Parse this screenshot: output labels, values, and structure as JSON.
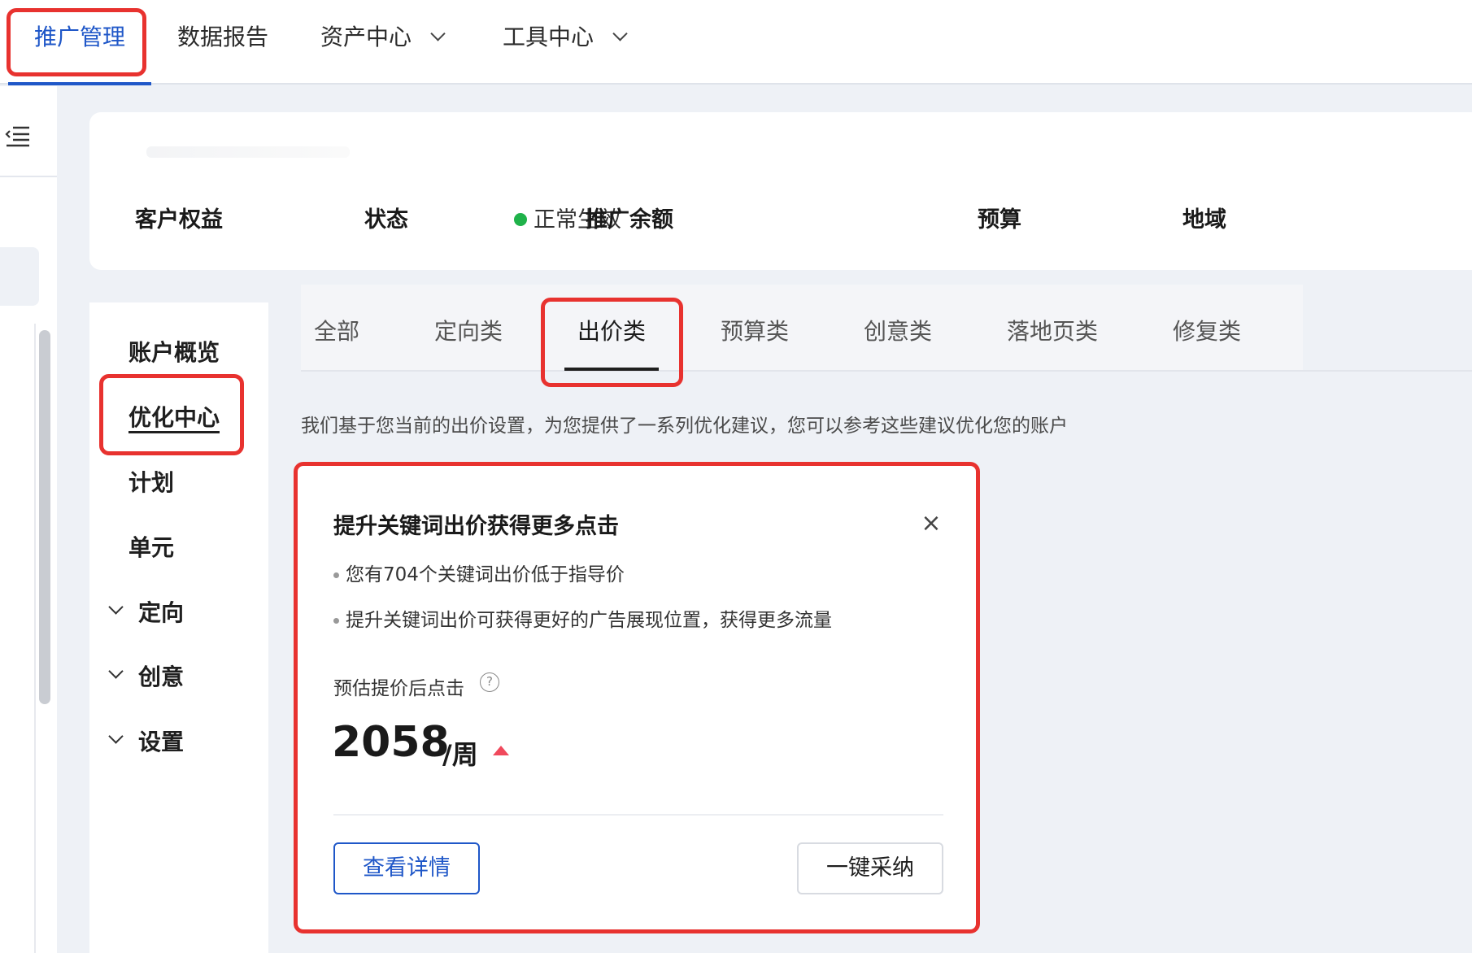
{
  "top_nav": {
    "items": [
      {
        "label": "推广管理",
        "active": true,
        "has_dropdown": false
      },
      {
        "label": "数据报告",
        "active": false,
        "has_dropdown": false
      },
      {
        "label": "资产中心",
        "active": false,
        "has_dropdown": true
      },
      {
        "label": "工具中心",
        "active": false,
        "has_dropdown": true
      }
    ]
  },
  "left_rail": {
    "toggle_icon": "menu-collapse-icon"
  },
  "summary": {
    "customer_rights_label": "客户权益",
    "status_label": "状态",
    "status_value": "正常生效",
    "balance_label": "推广余额",
    "budget_label": "预算",
    "region_label": "地域"
  },
  "side_menu": {
    "items": [
      {
        "label": "账户概览",
        "expandable": false
      },
      {
        "label": "优化中心",
        "expandable": false,
        "active": true
      },
      {
        "label": "计划",
        "expandable": false
      },
      {
        "label": "单元",
        "expandable": false
      },
      {
        "label": "定向",
        "expandable": true
      },
      {
        "label": "创意",
        "expandable": true
      },
      {
        "label": "设置",
        "expandable": true
      }
    ]
  },
  "tabs": {
    "items": [
      "全部",
      "定向类",
      "出价类",
      "预算类",
      "创意类",
      "落地页类",
      "修复类"
    ],
    "active_index": 2
  },
  "intro_text": "我们基于您当前的出价设置，为您提供了一系列优化建议，您可以参考这些建议优化您的账户",
  "suggestion": {
    "title": "提升关键词出价获得更多点击",
    "bullets": [
      "您有704个关键词出价低于指导价",
      "提升关键词出价可获得更好的广告展现位置，获得更多流量"
    ],
    "estimate_label": "预估提价后点击",
    "help_glyph": "?",
    "close_glyph": "×",
    "metric_value": "2058",
    "metric_unit": "/周",
    "detail_button": "查看详情",
    "adopt_button": "一键采纳"
  },
  "colors": {
    "brand_blue": "#1f57c8",
    "highlight_red": "#e8322f",
    "status_green": "#1fb24a",
    "trend_up_red": "#f0495c"
  }
}
